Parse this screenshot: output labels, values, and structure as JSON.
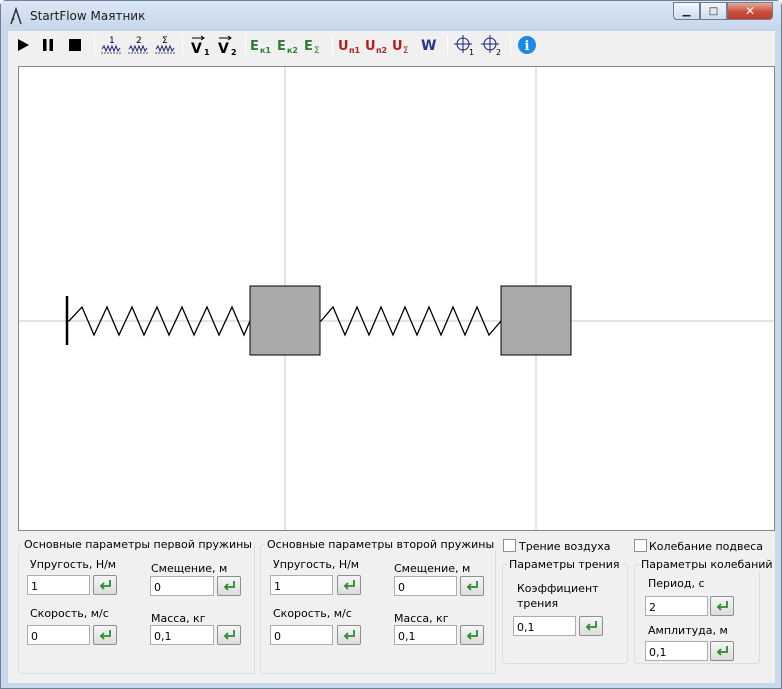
{
  "window": {
    "title": "StartFlow Маятник",
    "minimize_glyph": "▁",
    "maximize_glyph": "□",
    "close_glyph": "✕"
  },
  "toolbar": {
    "items": [
      {
        "icon": "play-icon"
      },
      {
        "icon": "pause-icon"
      },
      {
        "icon": "stop-icon"
      },
      {
        "icon": "spring-1-icon",
        "label": "1"
      },
      {
        "icon": "spring-2-icon",
        "label": "2"
      },
      {
        "icon": "spring-sum-icon",
        "label": "Σ"
      },
      {
        "icon": "velocity-1-icon",
        "label": "V",
        "sub": "1"
      },
      {
        "icon": "velocity-2-icon",
        "label": "V",
        "sub": "2"
      },
      {
        "icon": "kinetic-energy-1-icon",
        "label": "E",
        "sub": "к1",
        "color": "#2e7d32"
      },
      {
        "icon": "kinetic-energy-2-icon",
        "label": "E",
        "sub": "к2",
        "color": "#2e7d32"
      },
      {
        "icon": "kinetic-energy-sum-icon",
        "label": "E",
        "sub": "Σ",
        "color": "#2e7d32"
      },
      {
        "icon": "potential-energy-1-icon",
        "label": "U",
        "sub": "п1",
        "color": "#b71c1c"
      },
      {
        "icon": "potential-energy-2-icon",
        "label": "U",
        "sub": "п2",
        "color": "#b71c1c"
      },
      {
        "icon": "potential-energy-sum-icon",
        "label": "U",
        "sub": "Σ",
        "color": "#b71c1c"
      },
      {
        "icon": "work-icon",
        "label": "W",
        "color": "#283593"
      },
      {
        "icon": "crosshair-1-icon",
        "label": "1"
      },
      {
        "icon": "crosshair-2-icon",
        "label": "2"
      },
      {
        "icon": "info-icon",
        "label": "i",
        "color": "#1e88e5"
      }
    ]
  },
  "spring1": {
    "group_title": "Основные параметры первой пружины",
    "stiffness_label": "Упругость, Н/м",
    "stiffness_value": "1",
    "displacement_label": "Смещение, м",
    "displacement_value": "0",
    "velocity_label": "Скорость, м/с",
    "velocity_value": "0",
    "mass_label": "Масса, кг",
    "mass_value": "0,1"
  },
  "spring2": {
    "group_title": "Основные параметры второй пружины",
    "stiffness_label": "Упругость, Н/м",
    "stiffness_value": "1",
    "displacement_label": "Смещение, м",
    "displacement_value": "0",
    "velocity_label": "Скорость, м/с",
    "velocity_value": "0",
    "mass_label": "Масса, кг",
    "mass_value": "0,1"
  },
  "friction": {
    "air_friction_label": "Трение воздуха",
    "air_friction_checked": false,
    "group_title": "Параметры трения",
    "coef_label_line1": "Коэффициент",
    "coef_label_line2": "трения",
    "coef_value": "0,1"
  },
  "oscillation": {
    "suspension_label": "Колебание подвеса",
    "suspension_checked": false,
    "group_title": "Параметры колебаний",
    "period_label": "Период, с",
    "period_value": "2",
    "amplitude_label": "Амплитуда, м",
    "amplitude_value": "0,1"
  },
  "colors": {
    "mass_fill": "#aaaaaa",
    "axis_line": "#c8c8c8",
    "enter_arrow": "#2e8b2e"
  }
}
